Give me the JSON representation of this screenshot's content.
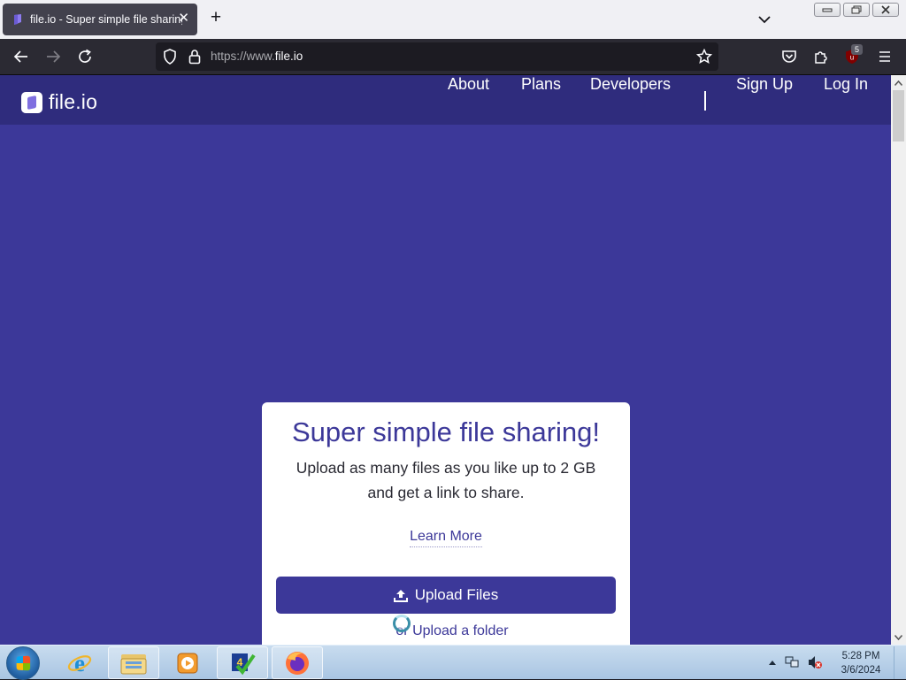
{
  "browser": {
    "tab": {
      "title": "file.io - Super simple file sharing",
      "close_icon": "close-icon",
      "favicon": "file-io-favicon"
    },
    "new_tab_label": "+",
    "url": {
      "protocol": "https://www.",
      "domain": "file.io"
    },
    "extension_badge": "5"
  },
  "site": {
    "logo_text": "file.io",
    "nav": {
      "about": "About",
      "plans": "Plans",
      "developers": "Developers",
      "sign_up": "Sign Up",
      "log_in": "Log In"
    },
    "hero": {
      "title": "Super simple file sharing!",
      "tagline_line1": "Upload as many files as you like up to 2 GB",
      "tagline_line2": "and get a link to share.",
      "learn_more": "Learn More",
      "upload_button": "Upload Files",
      "folder_prefix": "or",
      "folder_link": "Upload a folder"
    },
    "colors": {
      "brand": "#3c3899",
      "header": "#2f2c7d"
    }
  },
  "taskbar": {
    "clock_time": "5:28 PM",
    "clock_date": "3/6/2024",
    "apps": [
      "internet-explorer",
      "file-explorer",
      "media-player",
      "task-app",
      "firefox"
    ]
  }
}
